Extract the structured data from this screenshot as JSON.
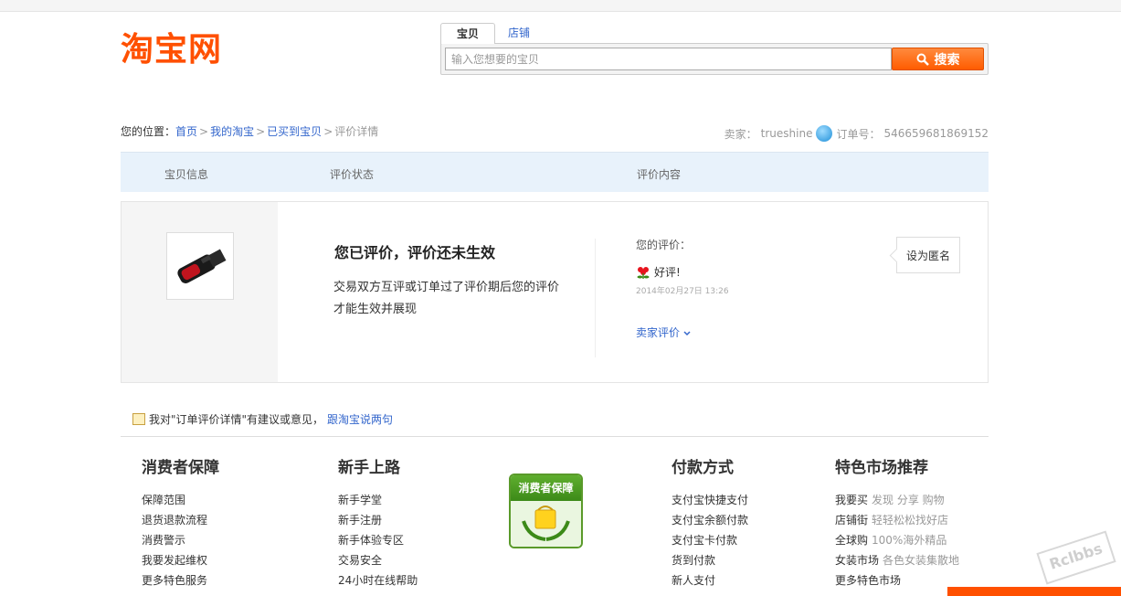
{
  "header": {
    "logo_text": "淘宝网",
    "tabs": [
      {
        "label": "宝贝"
      },
      {
        "label": "店铺"
      }
    ],
    "search": {
      "placeholder": "输入您想要的宝贝",
      "button_label": "搜索"
    }
  },
  "breadcrumb": {
    "prefix": "您的位置：",
    "items": [
      {
        "label": "首页"
      },
      {
        "label": "我的淘宝"
      },
      {
        "label": "已买到宝贝"
      }
    ],
    "separator": ">",
    "current": "评价详情"
  },
  "order": {
    "seller_label": "卖家：",
    "seller_name": "trueshine",
    "order_label": "订单号：",
    "order_number": "546659681869152"
  },
  "table_headers": [
    "宝贝信息",
    "评价状态",
    "评价内容"
  ],
  "review": {
    "status_title": "您已评价，评价还未生效",
    "status_desc": "交易双方互评或订单过了评价期后您的评价才能生效并展现",
    "your_label": "您的评价：",
    "rating": "好评!",
    "date": "2014年02月27日 13:26",
    "seller_review_label": "卖家评价",
    "anon_button": "设为匿名"
  },
  "feedback": {
    "text": "我对\"订单评价详情\"有建议或意见，",
    "link": "跟淘宝说两句"
  },
  "footer": {
    "columns": [
      {
        "title": "消费者保障",
        "items": [
          {
            "label": "保障范围"
          },
          {
            "label": "退货退款流程"
          },
          {
            "label": "消费警示"
          },
          {
            "label": "我要发起维权"
          },
          {
            "label": "更多特色服务"
          }
        ]
      },
      {
        "title": "新手上路",
        "items": [
          {
            "label": "新手学堂"
          },
          {
            "label": "新手注册"
          },
          {
            "label": "新手体验专区"
          },
          {
            "label": "交易安全"
          },
          {
            "label": "24小时在线帮助"
          }
        ]
      },
      {
        "title": "付款方式",
        "items": [
          {
            "label": "支付宝快捷支付"
          },
          {
            "label": "支付宝余额付款"
          },
          {
            "label": "支付宝卡付款"
          },
          {
            "label": "货到付款"
          },
          {
            "label": "新人支付"
          }
        ]
      },
      {
        "title": "特色市场推荐",
        "items": [
          {
            "label": "我要买",
            "sub": "发现 分享 购物"
          },
          {
            "label": "店铺街",
            "sub": "轻轻松松找好店"
          },
          {
            "label": "全球购",
            "sub": "100%海外精品"
          },
          {
            "label": "女装市场",
            "sub": "各色女装集散地"
          },
          {
            "label": "更多特色市场",
            "sub": ""
          }
        ]
      }
    ],
    "badge_text": "消费者保障"
  },
  "watermark": "Rclbbs",
  "colors": {
    "brand": "#ff5000",
    "link": "#3366cc",
    "header_band": "#e8f2fb"
  }
}
